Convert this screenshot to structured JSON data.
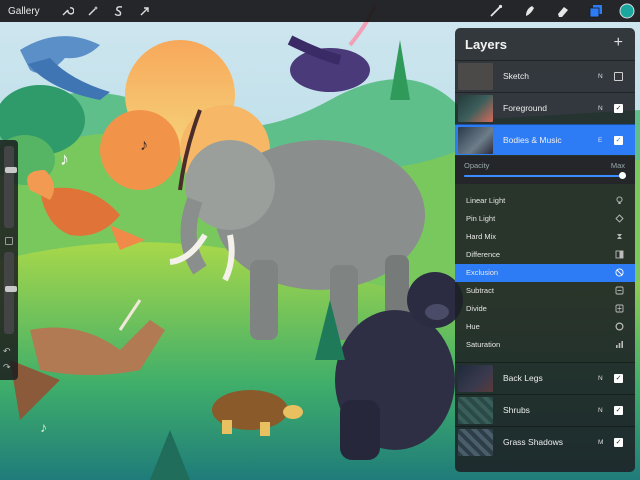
{
  "toolbar": {
    "gallery_label": "Gallery",
    "left_tools": [
      "wrench-icon",
      "magic-wand-icon",
      "selection-s-icon",
      "move-arrow-icon"
    ],
    "right_tools": [
      "brush-icon",
      "smudge-icon",
      "eraser-icon",
      "layers-icon",
      "color-swatch-icon"
    ],
    "active_color": "#1aa7a0"
  },
  "sidebar": {
    "size_slider_level": 0.72,
    "opacity_slider_level": 0.55
  },
  "layers_panel": {
    "title": "Layers",
    "add_label": "+",
    "top_layers": [
      {
        "name": "Sketch",
        "blend": "N",
        "visible": false,
        "active": false
      },
      {
        "name": "Foreground",
        "blend": "N",
        "visible": true,
        "active": false
      },
      {
        "name": "Bodies & Music",
        "blend": "E",
        "visible": true,
        "active": true
      }
    ],
    "opacity": {
      "label": "Opacity",
      "max_label": "Max",
      "value": 1.0
    },
    "blend_modes": [
      {
        "label": "Linear Light",
        "icon": "bulb-icon",
        "selected": false
      },
      {
        "label": "Pin Light",
        "icon": "diamond-icon",
        "selected": false
      },
      {
        "label": "Hard Mix",
        "icon": "hardmix-icon",
        "selected": false
      },
      {
        "label": "Difference",
        "icon": "difference-icon",
        "selected": false
      },
      {
        "label": "Exclusion",
        "icon": "exclusion-icon",
        "selected": true
      },
      {
        "label": "Subtract",
        "icon": "subtract-icon",
        "selected": false
      },
      {
        "label": "Divide",
        "icon": "divide-icon",
        "selected": false
      },
      {
        "label": "Hue",
        "icon": "hue-icon",
        "selected": false
      },
      {
        "label": "Saturation",
        "icon": "saturation-icon",
        "selected": false
      }
    ],
    "bottom_layers": [
      {
        "name": "Back Legs",
        "blend": "N",
        "visible": true
      },
      {
        "name": "Shrubs",
        "blend": "N",
        "visible": true
      },
      {
        "name": "Grass Shadows",
        "blend": "M",
        "visible": true
      }
    ]
  },
  "colors": {
    "accent_blue": "#2d7cf6",
    "panel_bg": "#1e2024"
  }
}
